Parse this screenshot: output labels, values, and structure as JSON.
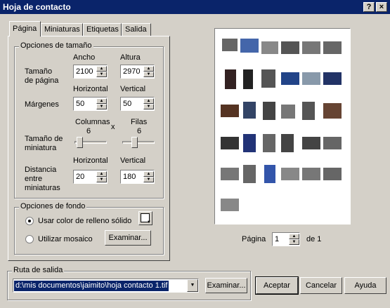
{
  "window": {
    "title": "Hoja de contacto",
    "help_btn": "?",
    "close_btn": "×"
  },
  "tabs": [
    "Página",
    "Miniaturas",
    "Etiquetas",
    "Salida"
  ],
  "size_group": {
    "legend": "Opciones de tamaño",
    "width_label": "Ancho",
    "height_label": "Altura",
    "page_size_label_1": "Tamaño",
    "page_size_label_2": "de página",
    "page_width": "2100",
    "page_height": "2970",
    "horizontal_label": "Horizontal",
    "vertical_label": "Vertical",
    "margins_label": "Márgenes",
    "margin_h": "50",
    "margin_v": "50",
    "columns_label": "Columnas",
    "columns_value": "6",
    "x_label": "x",
    "rows_label": "Filas",
    "rows_value": "6",
    "thumb_size_label_1": "Tamaño de",
    "thumb_size_label_2": "miniatura",
    "horizontal_label_2": "Horizontal",
    "vertical_label_2": "Vertical",
    "distance_label_1": "Distancia",
    "distance_label_2": "entre",
    "distance_label_3": "miniaturas",
    "distance_h": "20",
    "distance_v": "180"
  },
  "background_group": {
    "legend": "Opciones de fondo",
    "solid_label": "Usar color de relleno sólido",
    "mosaic_label": "Utilizar mosaico",
    "browse_label": "Examinar...",
    "solid_color": "#ffffff"
  },
  "preview": {
    "page_label": "Página",
    "page_value": "1",
    "of_label": "de 1"
  },
  "output": {
    "legend": "Ruta de salida",
    "path": "d:\\mis documentos\\jaimito\\hoja contacto 1.tif",
    "browse_label": "Examinar..."
  },
  "buttons": {
    "accept": "Aceptar",
    "cancel": "Cancelar",
    "help": "Ayuda"
  }
}
